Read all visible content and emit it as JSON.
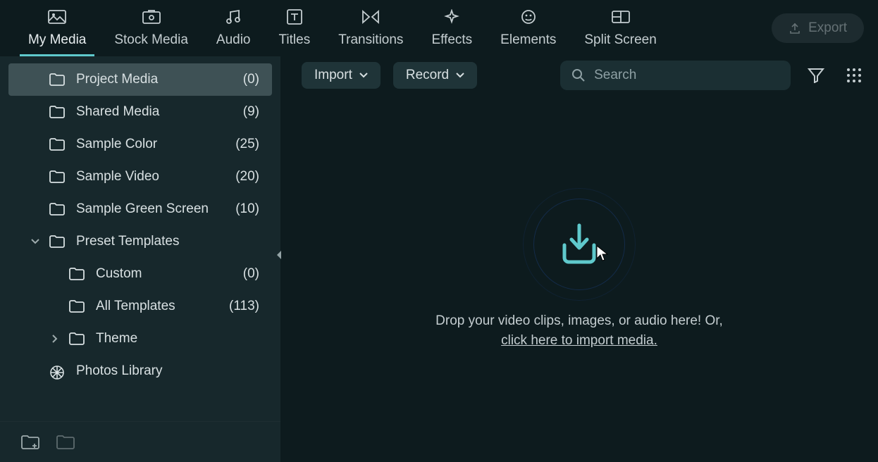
{
  "topTabs": [
    {
      "label": "My Media"
    },
    {
      "label": "Stock Media"
    },
    {
      "label": "Audio"
    },
    {
      "label": "Titles"
    },
    {
      "label": "Transitions"
    },
    {
      "label": "Effects"
    },
    {
      "label": "Elements"
    },
    {
      "label": "Split Screen"
    }
  ],
  "export": "Export",
  "sidebar": {
    "projectMedia": {
      "name": "Project Media",
      "count": "(0)"
    },
    "sharedMedia": {
      "name": "Shared Media",
      "count": "(9)"
    },
    "sampleColor": {
      "name": "Sample Color",
      "count": "(25)"
    },
    "sampleVideo": {
      "name": "Sample Video",
      "count": "(20)"
    },
    "sampleGreen": {
      "name": "Sample Green Screen",
      "count": "(10)"
    },
    "presetTemplates": {
      "name": "Preset Templates"
    },
    "custom": {
      "name": "Custom",
      "count": "(0)"
    },
    "allTemplates": {
      "name": "All Templates",
      "count": "(113)"
    },
    "theme": {
      "name": "Theme"
    },
    "photosLibrary": {
      "name": "Photos Library"
    }
  },
  "toolbar": {
    "import": "Import",
    "record": "Record",
    "searchPlaceholder": "Search"
  },
  "dropzone": {
    "line1": "Drop your video clips, images, or audio here! Or,",
    "link": "click here to import media."
  }
}
